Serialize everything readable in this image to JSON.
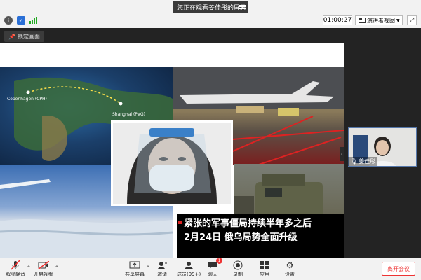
{
  "top": {
    "share_banner": "您正在观看姜佳彤的屏幕",
    "timer": "01:00:27",
    "view_button": "演讲者视图"
  },
  "stage": {
    "lock_button": "锁定画面",
    "map_labels": {
      "origin": "Copenhagen (CPH)",
      "dest": "Shanghai (PVG)"
    },
    "news_line1": "紧张的军事僵局持续半年多之后",
    "news_line2": "2月24日 俄乌局势全面升级",
    "participant_name": "姜佳彤"
  },
  "toolbar": {
    "mute": "解除静音",
    "video": "开启视频",
    "share": "共享屏幕",
    "invite": "邀请",
    "members": "成员(99+)",
    "chat": "聊天",
    "chat_badge": "1",
    "record": "录制",
    "apps": "应用",
    "settings": "设置",
    "leave": "离开会议"
  },
  "colors": {
    "accent_red": "#e33333",
    "stage_bg": "#232323",
    "toolbar_bg": "#f2f2f2"
  }
}
